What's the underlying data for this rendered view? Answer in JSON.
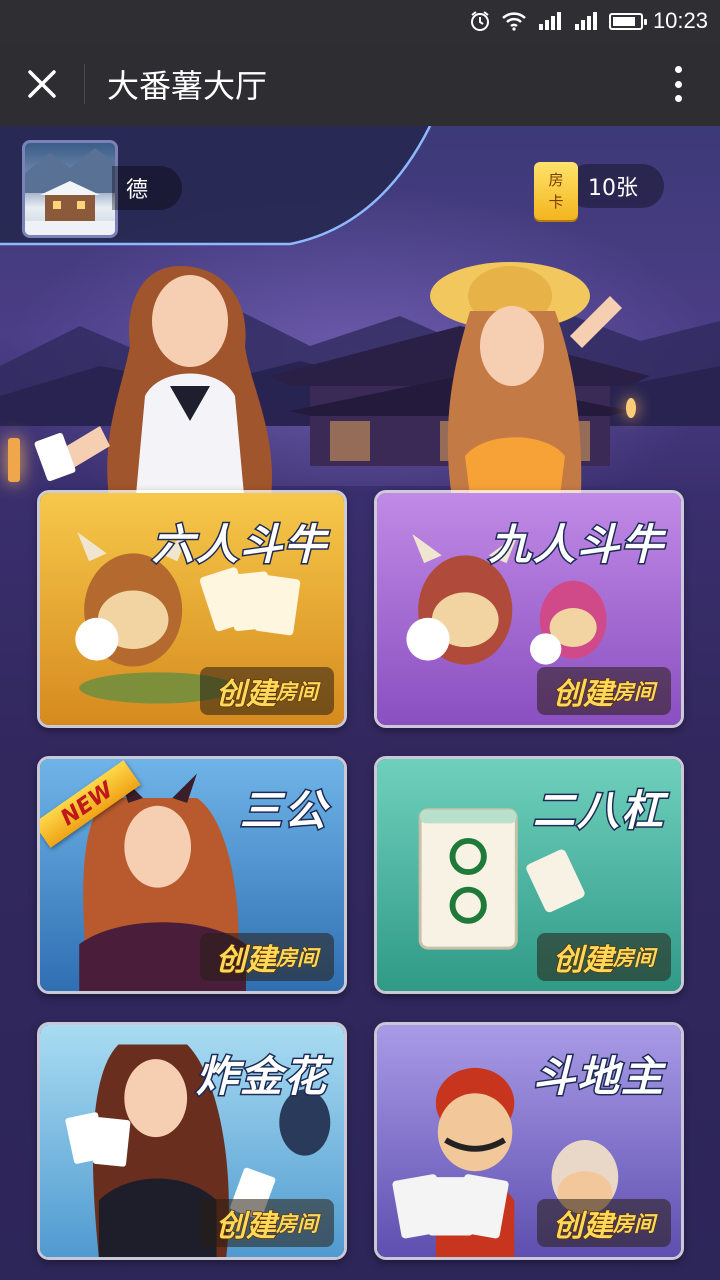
{
  "status_bar": {
    "time": "10:23",
    "icons": [
      "alarm-icon",
      "wifi-icon",
      "signal-icon",
      "signal-icon",
      "battery-icon"
    ],
    "battery_level": 0.85
  },
  "title_bar": {
    "title": "大番薯大厅",
    "close_icon": "close-icon",
    "more_icon": "more-vertical-icon"
  },
  "player": {
    "nickname": "德",
    "room_card_label_top": "房",
    "room_card_label_bottom": "卡",
    "room_cards": "10张"
  },
  "games": [
    {
      "name": "六人斗牛",
      "create_big": "创建",
      "create_small": "房间",
      "theme": "#e8a52a",
      "is_new": false
    },
    {
      "name": "九人斗牛",
      "create_big": "创建",
      "create_small": "房间",
      "theme": "#a66bd0",
      "is_new": false
    },
    {
      "name": "三公",
      "create_big": "创建",
      "create_small": "房间",
      "theme": "#3d7fc8",
      "is_new": true,
      "badge": "NEW"
    },
    {
      "name": "二八杠",
      "create_big": "创建",
      "create_small": "房间",
      "theme": "#3fae9a",
      "is_new": false
    },
    {
      "name": "炸金花",
      "create_big": "创建",
      "create_small": "房间",
      "theme": "#58a6d8",
      "is_new": false
    },
    {
      "name": "斗地主",
      "create_big": "创建",
      "create_small": "房间",
      "theme": "#7a6bc8",
      "is_new": false
    }
  ]
}
